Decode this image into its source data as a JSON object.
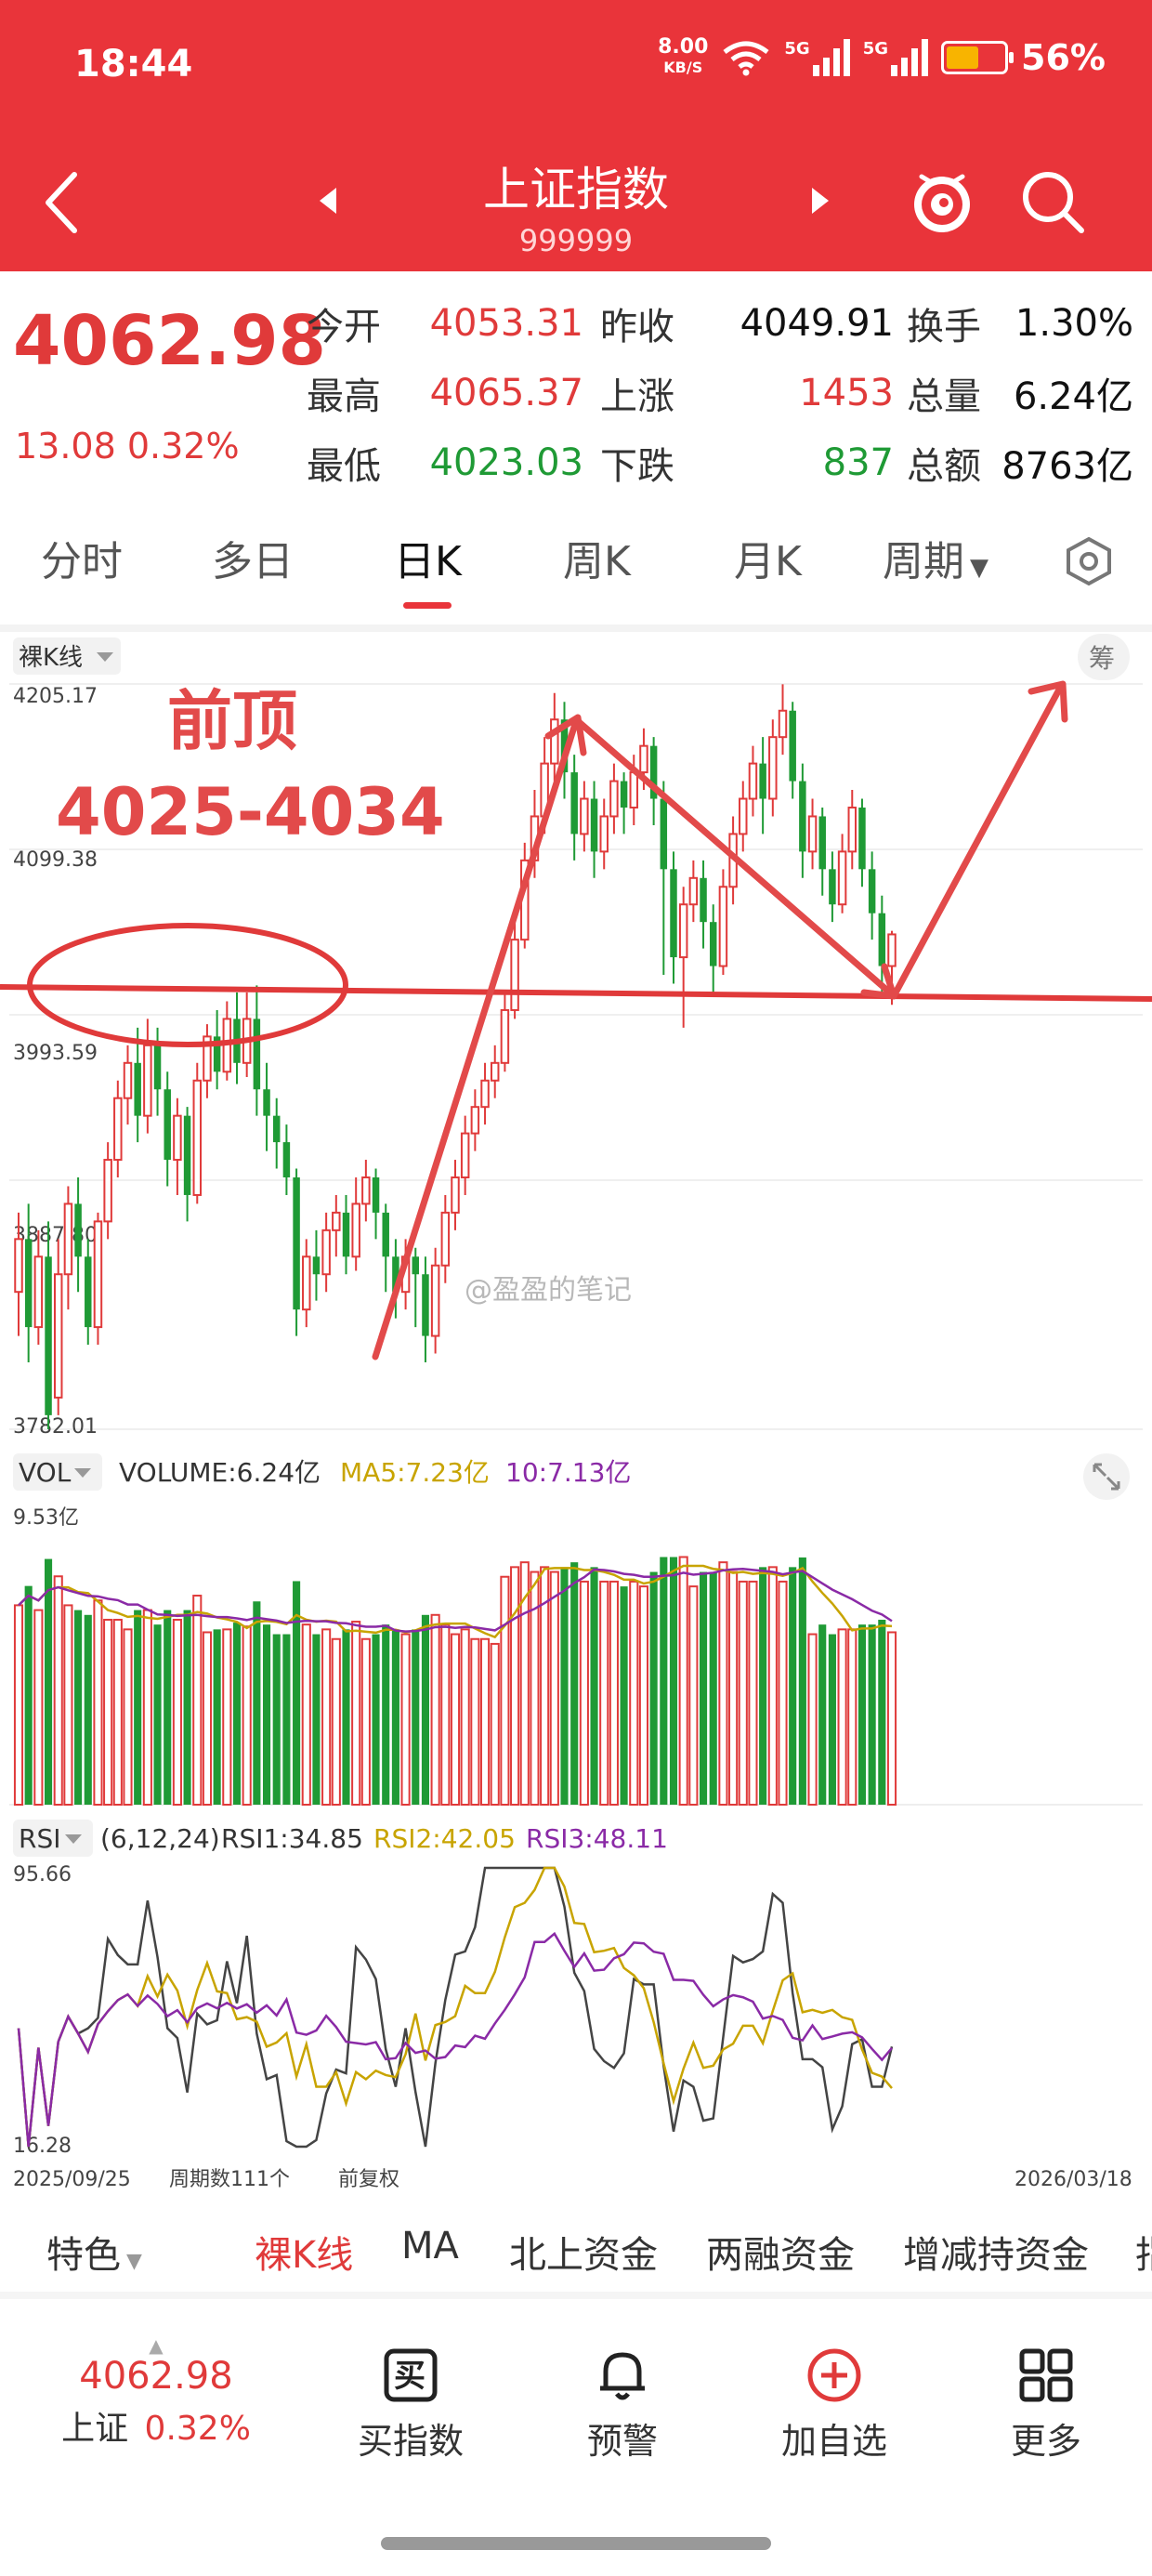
{
  "status": {
    "time": "18:44",
    "net_speed": "8.00",
    "net_unit": "KB/S",
    "sig1": "5G",
    "sig2": "5G",
    "battery": "56%"
  },
  "header": {
    "title": "上证指数",
    "code": "999999"
  },
  "quote": {
    "price": "4062.98",
    "change": "13.08  0.32%",
    "rows": [
      {
        "l1": "今开",
        "v1": "4053.31",
        "l2": "昨收",
        "v2": "4049.91",
        "l3": "换手",
        "v3": "1.30%"
      },
      {
        "l1": "最高",
        "v1": "4065.37",
        "l2": "上涨",
        "v2": "1453",
        "l3": "总量",
        "v3": "6.24亿"
      },
      {
        "l1": "最低",
        "v1": "4023.03",
        "l2": "下跌",
        "v2": "837",
        "l3": "总额",
        "v3": "8763亿"
      }
    ]
  },
  "tabs": [
    "分时",
    "多日",
    "日K",
    "周K",
    "月K",
    "周期"
  ],
  "kline": {
    "selector": "裸K线",
    "chip_label": "筹",
    "y_labels": [
      "4205.17",
      "4099.38",
      "3993.59",
      "3887.80",
      "3782.01"
    ],
    "annotation_title": "前顶",
    "annotation_range": "4025-4034",
    "watermark": "@盈盈的笔记"
  },
  "volume": {
    "selector": "VOL",
    "label": "VOLUME:6.24亿",
    "ma5": "MA5:7.23亿",
    "ma10": "10:7.13亿",
    "y_max": "9.53亿"
  },
  "rsi": {
    "selector": "RSI",
    "params": "(6,12,24)",
    "rsi1": "RSI1:34.85",
    "rsi2": "RSI2:42.05",
    "rsi3": "RSI3:48.11",
    "y_max": "95.66",
    "y_min": "16.28"
  },
  "footer_axis": {
    "start_date": "2025/09/25",
    "period_count": "周期数111个",
    "adjust": "前复权",
    "end_date": "2026/03/18"
  },
  "indicator_tabs": [
    "特色",
    "裸K线",
    "MA",
    "北上资金",
    "两融资金",
    "增减持资金",
    "指"
  ],
  "bottom_nav": {
    "price": "4062.98",
    "name": "上证",
    "pct": "0.32%",
    "items": [
      {
        "label": "买指数",
        "icon_text": "买"
      },
      {
        "label": "预警"
      },
      {
        "label": "加自选"
      },
      {
        "label": "更多"
      }
    ]
  },
  "colors": {
    "brand": "#e9343a",
    "up": "#e03a3a",
    "down": "#1f9a35",
    "ma5": "#c8a400",
    "ma10": "#8a2aa6"
  },
  "chart_data": {
    "type": "candlestick",
    "ylim": [
      3782.01,
      4205.17
    ],
    "candles": [
      [
        3860,
        3890,
        3835,
        3905,
        0
      ],
      [
        3890,
        3840,
        3820,
        3910,
        1
      ],
      [
        3840,
        3880,
        3830,
        3895,
        0
      ],
      [
        3880,
        3790,
        3782,
        3900,
        1
      ],
      [
        3800,
        3870,
        3790,
        3890,
        0
      ],
      [
        3870,
        3910,
        3850,
        3920,
        0
      ],
      [
        3910,
        3880,
        3860,
        3925,
        1
      ],
      [
        3880,
        3840,
        3830,
        3890,
        1
      ],
      [
        3840,
        3900,
        3830,
        3905,
        0
      ],
      [
        3900,
        3935,
        3890,
        3945,
        0
      ],
      [
        3935,
        3970,
        3925,
        3980,
        0
      ],
      [
        3970,
        3990,
        3955,
        4000,
        0
      ],
      [
        3990,
        3960,
        3945,
        4010,
        1
      ],
      [
        3960,
        4000,
        3950,
        4015,
        0
      ],
      [
        4000,
        3975,
        3960,
        4010,
        1
      ],
      [
        3975,
        3935,
        3920,
        3985,
        1
      ],
      [
        3935,
        3960,
        3915,
        3970,
        0
      ],
      [
        3960,
        3915,
        3900,
        3965,
        1
      ],
      [
        3915,
        3980,
        3910,
        3990,
        0
      ],
      [
        3980,
        4005,
        3970,
        4012,
        0
      ],
      [
        4005,
        3985,
        3975,
        4020,
        1
      ],
      [
        3985,
        4015,
        3980,
        4025,
        0
      ],
      [
        4015,
        3990,
        3978,
        4030,
        1
      ],
      [
        3990,
        4015,
        3982,
        4030,
        0
      ],
      [
        4015,
        3975,
        3960,
        4034,
        1
      ],
      [
        3975,
        3960,
        3940,
        3990,
        1
      ],
      [
        3960,
        3945,
        3930,
        3970,
        1
      ],
      [
        3945,
        3925,
        3915,
        3955,
        1
      ],
      [
        3925,
        3850,
        3835,
        3930,
        1
      ],
      [
        3850,
        3880,
        3840,
        3890,
        0
      ],
      [
        3880,
        3870,
        3855,
        3895,
        1
      ],
      [
        3870,
        3895,
        3860,
        3905,
        0
      ],
      [
        3895,
        3905,
        3880,
        3915,
        0
      ],
      [
        3905,
        3880,
        3870,
        3915,
        1
      ],
      [
        3880,
        3910,
        3872,
        3925,
        0
      ],
      [
        3910,
        3925,
        3900,
        3935,
        0
      ],
      [
        3925,
        3905,
        3890,
        3930,
        1
      ],
      [
        3905,
        3880,
        3860,
        3910,
        1
      ],
      [
        3880,
        3860,
        3845,
        3890,
        1
      ],
      [
        3860,
        3880,
        3850,
        3890,
        0
      ],
      [
        3880,
        3870,
        3840,
        3885,
        1
      ],
      [
        3870,
        3835,
        3820,
        3880,
        1
      ],
      [
        3835,
        3875,
        3825,
        3885,
        0
      ],
      [
        3875,
        3905,
        3865,
        3915,
        0
      ],
      [
        3905,
        3925,
        3895,
        3935,
        0
      ],
      [
        3925,
        3950,
        3915,
        3960,
        0
      ],
      [
        3950,
        3965,
        3940,
        3975,
        0
      ],
      [
        3965,
        3980,
        3955,
        3990,
        0
      ],
      [
        3980,
        3990,
        3970,
        4000,
        0
      ],
      [
        3990,
        4020,
        3985,
        4030,
        0
      ],
      [
        4020,
        4060,
        4015,
        4070,
        0
      ],
      [
        4060,
        4105,
        4055,
        4115,
        0
      ],
      [
        4105,
        4130,
        4095,
        4145,
        0
      ],
      [
        4130,
        4160,
        4120,
        4175,
        0
      ],
      [
        4160,
        4185,
        4150,
        4200,
        0
      ],
      [
        4185,
        4155,
        4140,
        4195,
        1
      ],
      [
        4155,
        4120,
        4105,
        4165,
        1
      ],
      [
        4120,
        4140,
        4110,
        4150,
        0
      ],
      [
        4140,
        4110,
        4095,
        4150,
        1
      ],
      [
        4110,
        4130,
        4100,
        4140,
        0
      ],
      [
        4130,
        4150,
        4120,
        4160,
        0
      ],
      [
        4150,
        4135,
        4120,
        4155,
        1
      ],
      [
        4135,
        4155,
        4125,
        4165,
        0
      ],
      [
        4155,
        4170,
        4145,
        4180,
        0
      ],
      [
        4170,
        4140,
        4125,
        4175,
        1
      ],
      [
        4140,
        4100,
        4040,
        4150,
        1
      ],
      [
        4100,
        4050,
        4035,
        4110,
        1
      ],
      [
        4050,
        4080,
        4010,
        4090,
        0
      ],
      [
        4080,
        4095,
        4070,
        4105,
        0
      ],
      [
        4095,
        4070,
        4055,
        4105,
        1
      ],
      [
        4070,
        4045,
        4030,
        4080,
        1
      ],
      [
        4045,
        4090,
        4040,
        4100,
        0
      ],
      [
        4090,
        4120,
        4080,
        4130,
        0
      ],
      [
        4120,
        4140,
        4110,
        4150,
        0
      ],
      [
        4140,
        4160,
        4130,
        4170,
        0
      ],
      [
        4160,
        4140,
        4120,
        4175,
        1
      ],
      [
        4140,
        4175,
        4130,
        4185,
        0
      ],
      [
        4175,
        4190,
        4165,
        4205,
        0
      ],
      [
        4190,
        4150,
        4140,
        4195,
        1
      ],
      [
        4150,
        4110,
        4095,
        4160,
        1
      ],
      [
        4110,
        4130,
        4100,
        4140,
        0
      ],
      [
        4130,
        4100,
        4085,
        4135,
        1
      ],
      [
        4100,
        4080,
        4070,
        4110,
        1
      ],
      [
        4080,
        4110,
        4075,
        4120,
        0
      ],
      [
        4110,
        4135,
        4100,
        4145,
        0
      ],
      [
        4135,
        4100,
        4090,
        4140,
        1
      ],
      [
        4100,
        4075,
        4060,
        4110,
        1
      ],
      [
        4075,
        4045,
        4030,
        4085,
        1
      ],
      [
        4045,
        4063,
        4023,
        4065,
        0
      ]
    ]
  }
}
